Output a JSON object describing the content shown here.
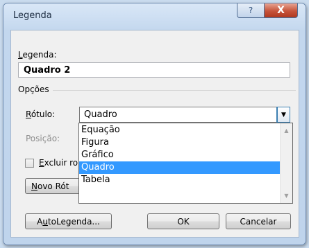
{
  "window": {
    "title": "Legenda",
    "help_glyph": "?",
    "close_glyph": "X"
  },
  "caption": {
    "label_first": "L",
    "label_rest": "egenda:",
    "value": "Quadro 2"
  },
  "options": {
    "group_label": "Opções",
    "label_field": {
      "label_first": "R",
      "label_rest": "ótulo:",
      "selected": "Quadro",
      "dropdown_icon": "chevron-down-icon"
    },
    "position_field": {
      "label": "Posição:"
    },
    "exclude_checkbox": {
      "label_first": "E",
      "label_rest": "xcluir ro",
      "checked": false
    },
    "new_label_button": {
      "label_first": "N",
      "label_rest": "ovo Rót"
    }
  },
  "dropdown": {
    "items": [
      "Equação",
      "Figura",
      "Gráfico",
      "Quadro",
      "Tabela"
    ],
    "selected_index": 3,
    "scroll_up_icon": "scroll-up-icon",
    "scroll_down_icon": "scroll-down-icon"
  },
  "buttons": {
    "autolegend_first": "A",
    "autolegend_mid": "u",
    "autolegend_rest": "toLegenda...",
    "ok": "OK",
    "cancel": "Cancelar"
  },
  "colors": {
    "selection": "#3399ff",
    "close_button": "#c6533a",
    "titlebar": "#c3d7ee"
  }
}
